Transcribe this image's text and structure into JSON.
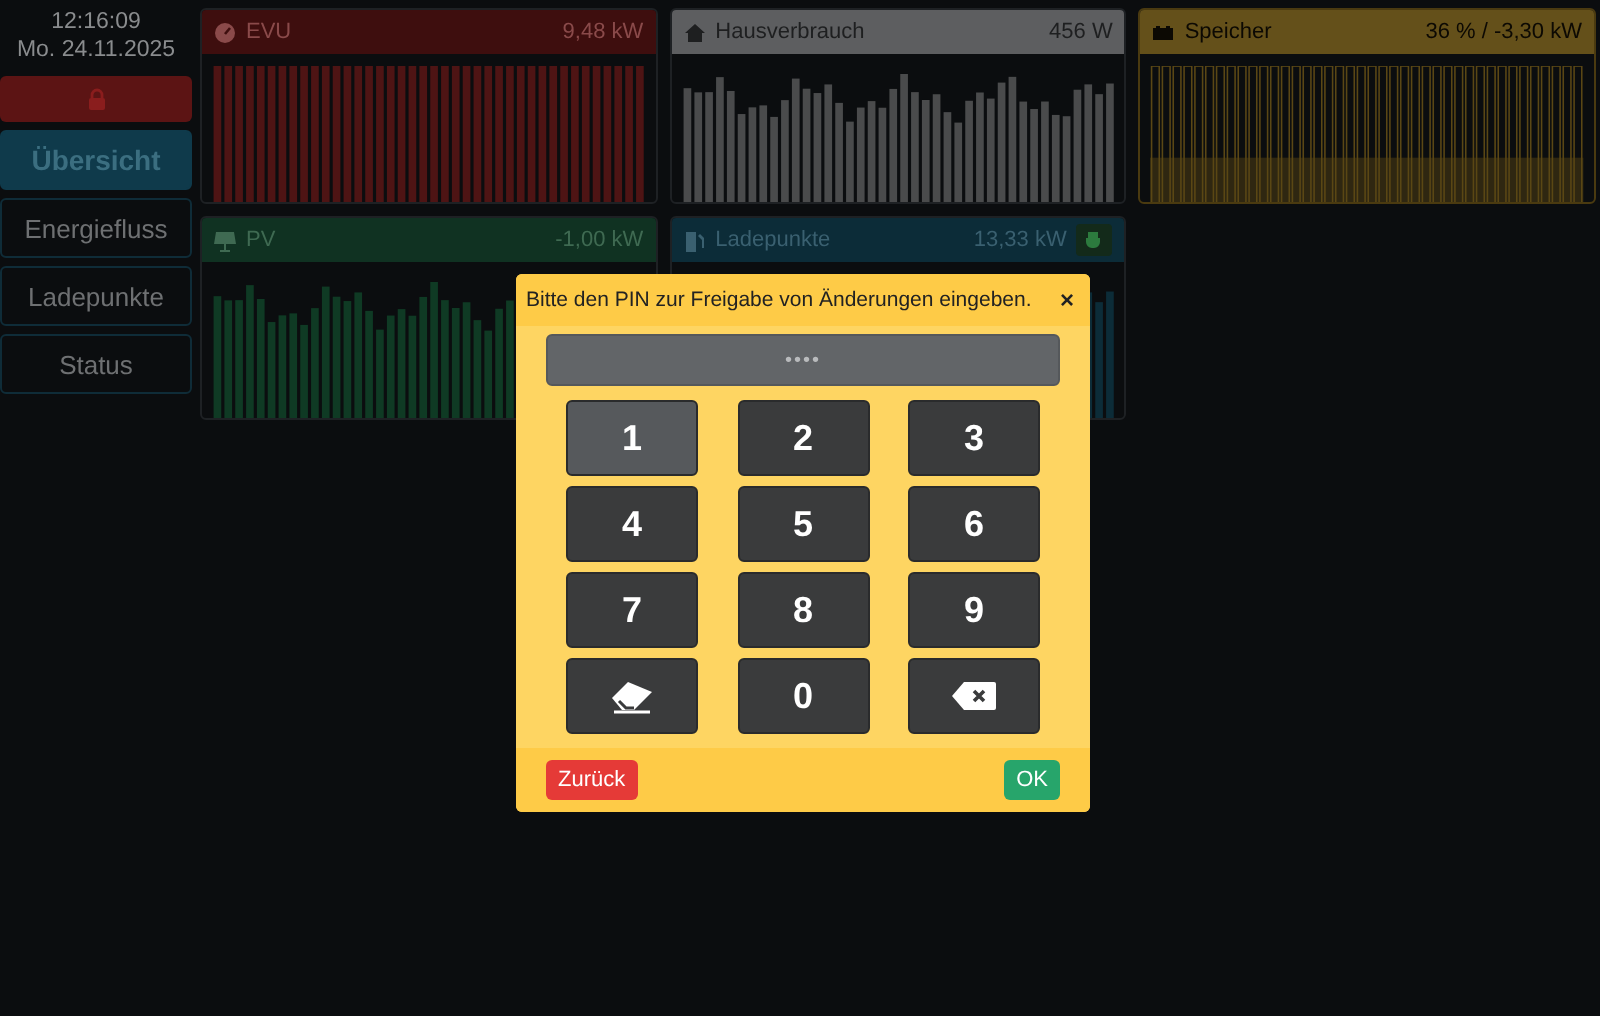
{
  "clock": {
    "time": "12:16:09",
    "date": "Mo. 24.11.2025"
  },
  "lock_button": {
    "locked": true
  },
  "nav": [
    {
      "label": "Übersicht",
      "selected": true
    },
    {
      "label": "Energiefluss",
      "selected": false
    },
    {
      "label": "Ladepunkte",
      "selected": false
    },
    {
      "label": "Status",
      "selected": false
    }
  ],
  "cards": [
    {
      "kind": "grid",
      "title": "EVU",
      "value": "9,48 kW"
    },
    {
      "kind": "house",
      "title": "Hausverbrauch",
      "value": "456 W"
    },
    {
      "kind": "battery",
      "title": "Speicher",
      "value": "36 % / -3,30 kW"
    },
    {
      "kind": "pv",
      "title": "PV",
      "value": "-1,00 kW"
    },
    {
      "kind": "chargepoint",
      "title": "Ladepunkte",
      "value": "13,33 kW"
    }
  ],
  "pin_dialog": {
    "title": "Bitte den PIN zur Freigabe von Änderungen eingeben.",
    "close": "×",
    "value": "••••",
    "keys": [
      {
        "kind": "digit",
        "label": "1",
        "hovered": true
      },
      {
        "kind": "digit",
        "label": "2",
        "hovered": false
      },
      {
        "kind": "digit",
        "label": "3",
        "hovered": false
      },
      {
        "kind": "digit",
        "label": "4",
        "hovered": false
      },
      {
        "kind": "digit",
        "label": "5",
        "hovered": false
      },
      {
        "kind": "digit",
        "label": "6",
        "hovered": false
      },
      {
        "kind": "digit",
        "label": "7",
        "hovered": false
      },
      {
        "kind": "digit",
        "label": "8",
        "hovered": false
      },
      {
        "kind": "digit",
        "label": "9",
        "hovered": false
      },
      {
        "kind": "clear",
        "hovered": false
      },
      {
        "kind": "digit",
        "label": "0",
        "hovered": false
      },
      {
        "kind": "backspace",
        "hovered": false
      }
    ],
    "back_button": "Zurück",
    "ok_button": "OK"
  }
}
